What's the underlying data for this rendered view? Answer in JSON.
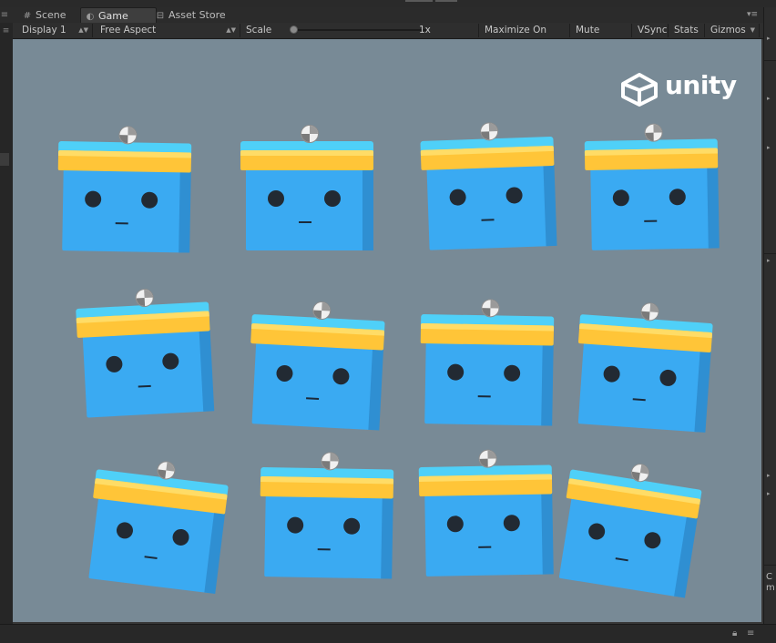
{
  "tabs": [
    {
      "label": "Scene",
      "icon": "scene-grid-icon",
      "active": false
    },
    {
      "label": "Game",
      "icon": "game-pacman-icon",
      "active": true
    },
    {
      "label": "Asset Store",
      "icon": "store-bag-icon",
      "active": false
    }
  ],
  "toolbar": {
    "display": "Display 1",
    "aspect": "Free Aspect",
    "scale_label": "Scale",
    "scale_value": "1x",
    "maximize": "Maximize On Play",
    "mute": "Mute Audio",
    "vsync": "VSync",
    "stats": "Stats",
    "gizmos": "Gizmos"
  },
  "game_view": {
    "background": "#788a96",
    "logo_text": "unity",
    "cube_count": 12,
    "colors": {
      "body": "#3aaaf2",
      "lid": "#4fd0f8",
      "band": "#ffc538",
      "eye": "#222a33"
    }
  },
  "right_panel": {
    "truncated_text": "C\nm"
  },
  "bottom": {
    "lock_icon": "lock-icon",
    "menu_icon": "context-menu-icon"
  }
}
